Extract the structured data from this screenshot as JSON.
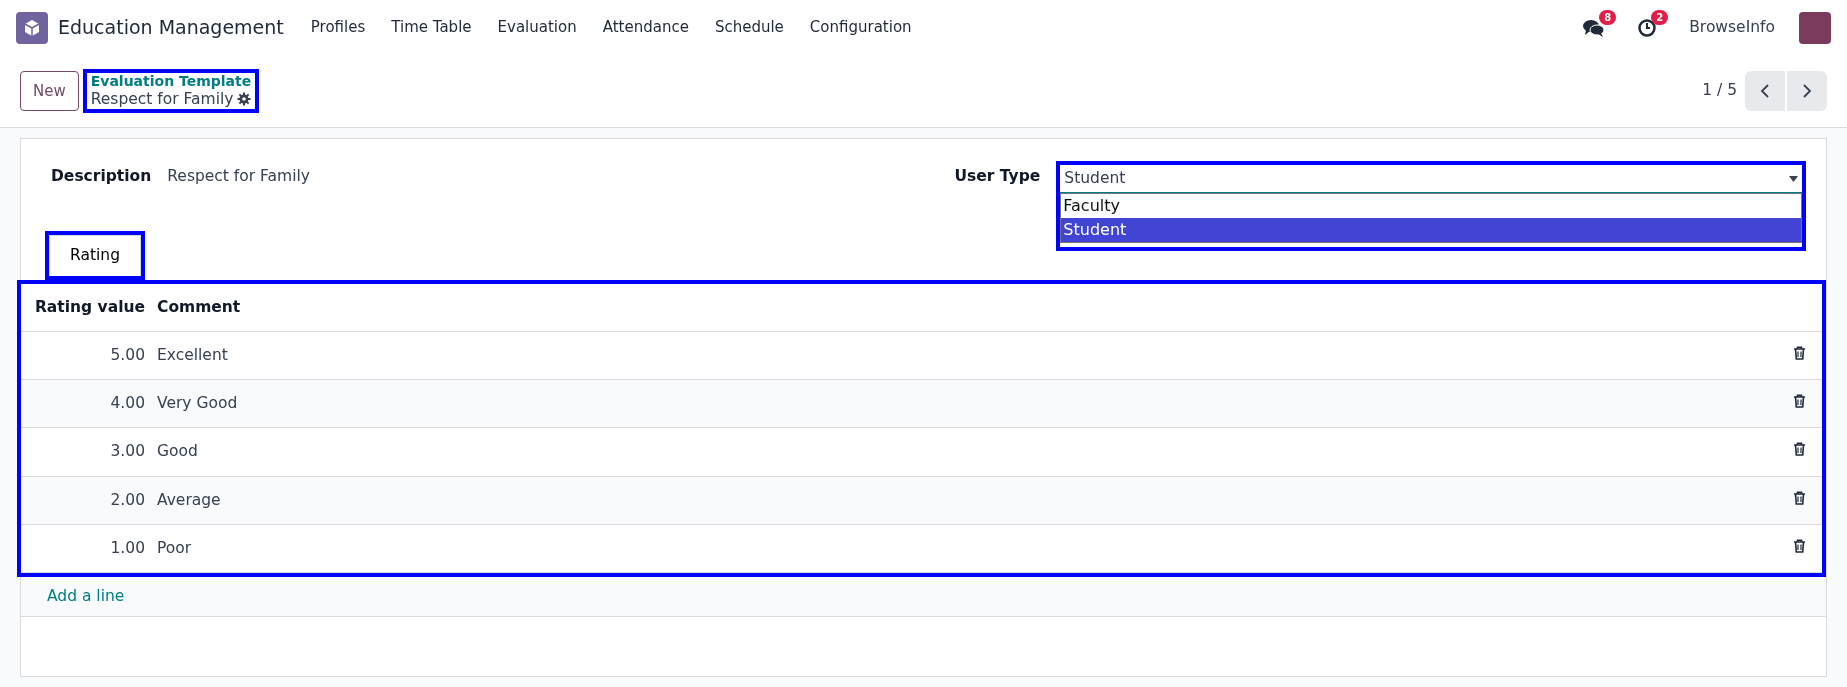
{
  "navbar": {
    "app_name": "Education Management",
    "menu": [
      "Profiles",
      "Time Table",
      "Evaluation",
      "Attendance",
      "Schedule",
      "Configuration"
    ],
    "messages_badge": "8",
    "activities_badge": "2",
    "user": "BrowseInfo"
  },
  "control_panel": {
    "new_button": "New",
    "breadcrumb": "Evaluation Template",
    "record": "Respect for Family",
    "pager": "1 / 5"
  },
  "form": {
    "description_label": "Description",
    "description": "Respect for Family",
    "user_type_label": "User Type",
    "user_type_value": "Student",
    "user_type_options": [
      {
        "label": "Faculty",
        "selected": false
      },
      {
        "label": "Student",
        "selected": true
      }
    ]
  },
  "tabs": [
    {
      "label": "Rating",
      "selected": true
    }
  ],
  "table": {
    "columns": [
      "Rating value",
      "Comment"
    ],
    "rows": [
      {
        "value": "5.00",
        "comment": "Excellent"
      },
      {
        "value": "4.00",
        "comment": "Very Good"
      },
      {
        "value": "3.00",
        "comment": "Good"
      },
      {
        "value": "2.00",
        "comment": "Average"
      },
      {
        "value": "1.00",
        "comment": "Poor"
      }
    ],
    "add_line": "Add a line"
  }
}
